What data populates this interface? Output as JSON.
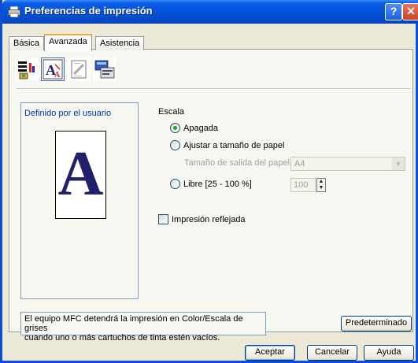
{
  "window": {
    "title": "Preferencias de impresión",
    "help_label": "?",
    "close_label": "✕"
  },
  "tabs": [
    {
      "label": "Básica"
    },
    {
      "label": "Avanzada",
      "active": true
    },
    {
      "label": "Asistencia"
    }
  ],
  "toolbar_icons": [
    "color-settings-icon",
    "scaling-icon",
    "watermark-icon",
    "device-options-icon"
  ],
  "preview": {
    "label": "Definido por el usuario",
    "letter": "A"
  },
  "scale": {
    "group_label": "Escala",
    "option_off": "Apagada",
    "option_fit": "Ajustar a tamaño de papel",
    "output_size_label": "Tamaño de salida del papel",
    "output_size_value": "A4",
    "option_free": "Libre [25 - 100 %]",
    "free_value": "100",
    "selected": "off"
  },
  "mirror": {
    "label": "Impresión reflejada",
    "checked": false
  },
  "info_text": {
    "line1": "El equipo MFC detendrá la impresión en Color/Escala de grises",
    "line2": "cuando uno o más cartuchos de tinta estén vacíos."
  },
  "buttons": {
    "default_label": "Predeterminado",
    "ok_label": "Aceptar",
    "cancel_label": "Cancelar",
    "help_label": "Ayuda"
  },
  "colors": {
    "titlebar": "#0453d9",
    "accent_tab": "#f5a82c",
    "preview_text": "#0033aa"
  }
}
